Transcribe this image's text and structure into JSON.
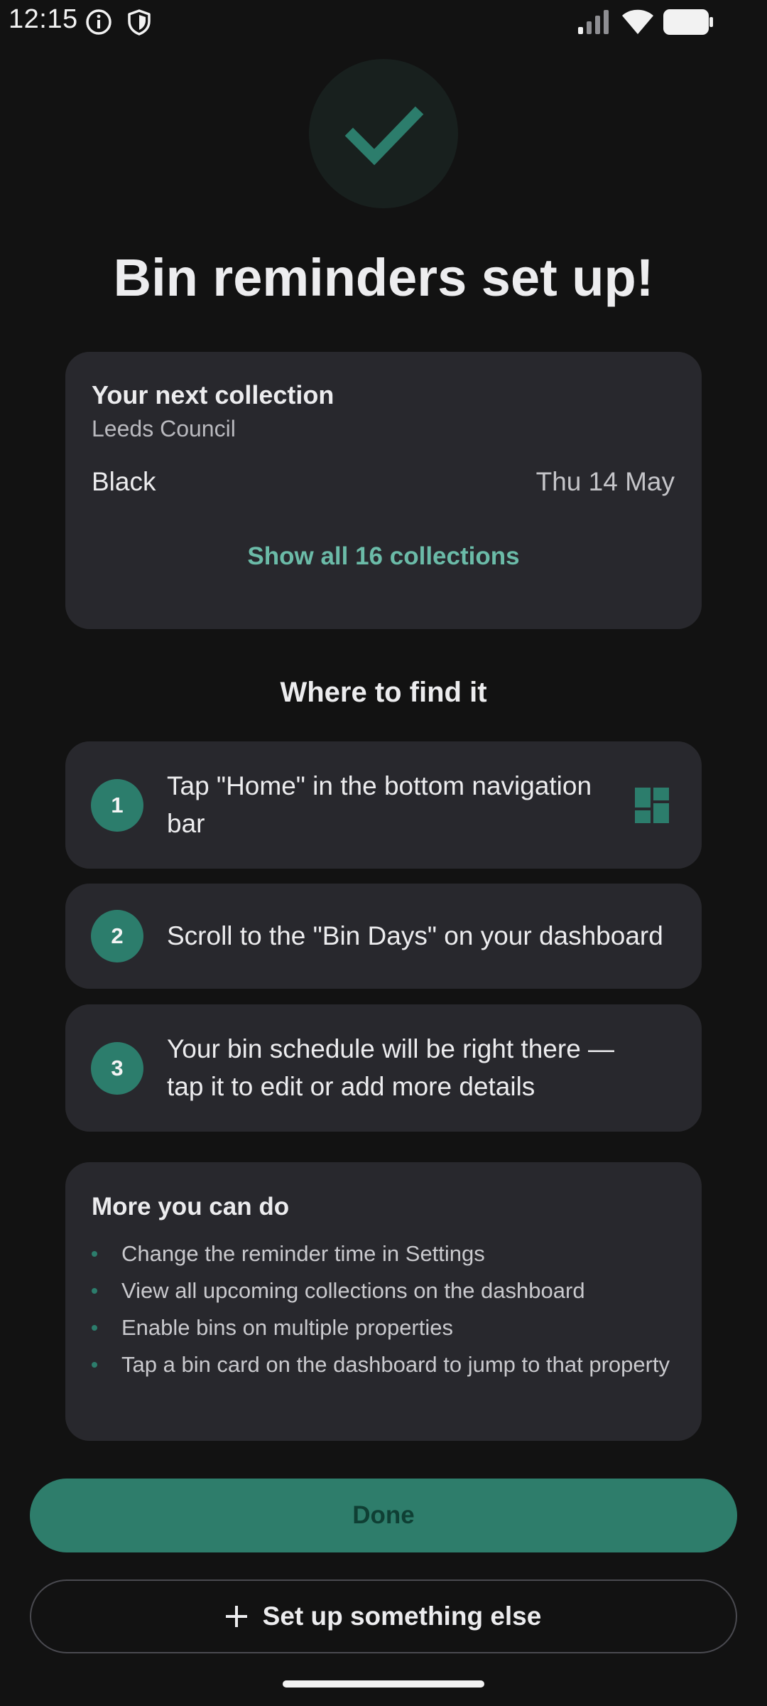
{
  "status_bar": {
    "time": "12:15",
    "icons": [
      "info-icon",
      "shield-icon",
      "signal-icon",
      "wifi-icon",
      "battery-icon"
    ]
  },
  "hero": {
    "icon": "check-icon",
    "title": "Bin reminders set up!"
  },
  "next_collection": {
    "heading": "Your next collection",
    "council": "Leeds Council",
    "bin": "Black",
    "date": "Thu 14 May",
    "show_all_label": "Show all 16 collections"
  },
  "where_to_find": {
    "title": "Where to find it",
    "steps": [
      {
        "number": "1",
        "text": "Tap \"Home\" in the bottom navigation bar",
        "icon": "dashboard-icon"
      },
      {
        "number": "2",
        "text": "Scroll to the \"Bin Days\" on your dashboard"
      },
      {
        "number": "3",
        "text": "Your bin schedule will be right there — tap it to edit or add more details"
      }
    ]
  },
  "more": {
    "heading": "More you can do",
    "items": [
      "Change the reminder time in Settings",
      "View all upcoming collections on the dashboard",
      "Enable bins on multiple properties",
      "Tap a bin card on the dashboard to jump to that property"
    ]
  },
  "actions": {
    "done_label": "Done",
    "setup_else_label": "Set up something else"
  },
  "colors": {
    "background": "#121212",
    "card": "#28282D",
    "accent": "#2E7D6B",
    "accent_text": "#6BBBA8"
  }
}
